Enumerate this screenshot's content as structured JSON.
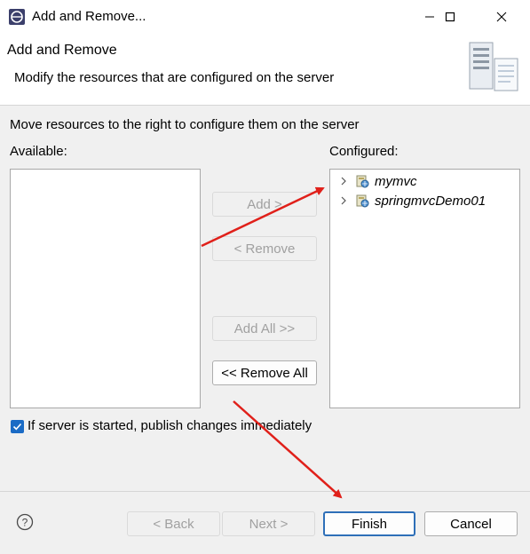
{
  "window": {
    "title": "Add and Remove..."
  },
  "header": {
    "title": "Add and Remove",
    "description": "Modify the resources that are configured on the server"
  },
  "body": {
    "instruction": "Move resources to the right to configure them on the server",
    "available_label": "Available:",
    "configured_label": "Configured:",
    "configured_items": [
      "mymvc",
      "springmvcDemo01"
    ]
  },
  "buttons": {
    "add": "Add >",
    "remove": "< Remove",
    "add_all": "Add All >>",
    "remove_all": "<< Remove All"
  },
  "publish": {
    "label": "If server is started, publish changes immediately",
    "checked": true
  },
  "footer": {
    "back": "< Back",
    "next": "Next >",
    "finish": "Finish",
    "cancel": "Cancel"
  },
  "colors": {
    "accent": "#1a6bc5",
    "annotation_arrow": "#e0201a"
  }
}
